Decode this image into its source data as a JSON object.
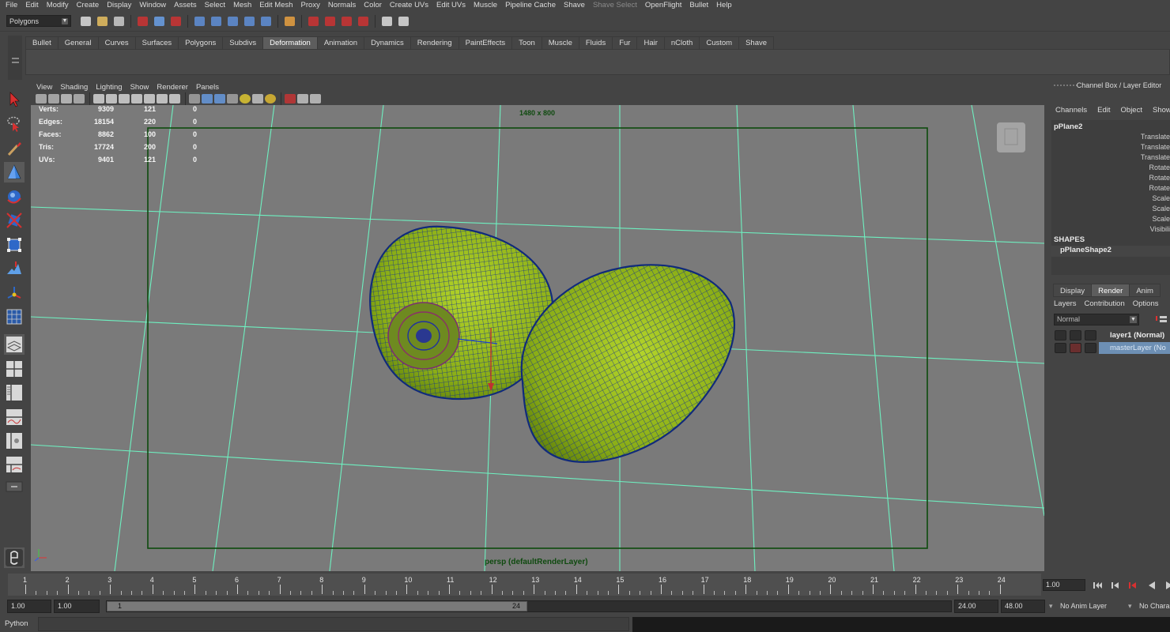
{
  "menubar": {
    "items": [
      "File",
      "Edit",
      "Modify",
      "Create",
      "Display",
      "Window",
      "Assets",
      "Select",
      "Mesh",
      "Edit Mesh",
      "Proxy",
      "Normals",
      "Color",
      "Create UVs",
      "Edit UVs",
      "Muscle",
      "Pipeline Cache",
      "Shave",
      "Shave Select",
      "OpenFlight",
      "Bullet",
      "Help"
    ],
    "disabled_item": "Shave Select"
  },
  "statusline": {
    "menuset": "Polygons",
    "tool_icons": [
      "new-scene-icon",
      "open-scene-icon",
      "save-scene-icon",
      "select-hierarchy-icon",
      "select-object-icon",
      "select-component-icon",
      "snap-grid-icon",
      "snap-curve-icon",
      "snap-point-icon",
      "snap-surface-icon",
      "snap-live-icon",
      "history-icon",
      "render-view-icon",
      "render-icon",
      "ipr-render-icon",
      "render-settings-icon",
      "hypershade-icon",
      "input-line-icon"
    ]
  },
  "shelf": {
    "tabs": [
      "Bullet",
      "General",
      "Curves",
      "Surfaces",
      "Polygons",
      "Subdivs",
      "Deformation",
      "Animation",
      "Dynamics",
      "Rendering",
      "PaintEffects",
      "Toon",
      "Muscle",
      "Fluids",
      "Fur",
      "Hair",
      "nCloth",
      "Custom",
      "Shave"
    ],
    "active_tab": "Deformation"
  },
  "toolbox": {
    "tools": [
      "select-tool-icon",
      "lasso-tool-icon",
      "paint-select-icon",
      "move-tool-icon",
      "rotate-tool-icon",
      "scale-tool-icon",
      "universal-manipulator-icon",
      "soft-mod-icon",
      "show-manipulator-icon",
      "grid-layout-icon",
      "single-perspective-layout-icon",
      "four-view-layout-icon",
      "persp-outliner-layout-icon",
      "persp-graph-layout-icon",
      "hypershade-layout-icon",
      "graph-outliner-layout-icon",
      "more-layouts-icon",
      "python-icon"
    ]
  },
  "viewport": {
    "panel_menu": [
      "View",
      "Shading",
      "Lighting",
      "Show",
      "Renderer",
      "Panels"
    ],
    "resolution_gate": "1480 x 800",
    "camera_label": "persp (defaultRenderLayer)",
    "hud": [
      {
        "label": "Verts:",
        "total": "9309",
        "selected": "121",
        "tris": "0"
      },
      {
        "label": "Edges:",
        "total": "18154",
        "selected": "220",
        "tris": "0"
      },
      {
        "label": "Faces:",
        "total": "8862",
        "selected": "100",
        "tris": "0"
      },
      {
        "label": "Tris:",
        "total": "17724",
        "selected": "200",
        "tris": "0"
      },
      {
        "label": "UVs:",
        "total": "9401",
        "selected": "121",
        "tris": "0"
      }
    ],
    "colors": {
      "background": "#7a7a7a",
      "grid": "#6ef0c0",
      "gate": "#0d4a0d",
      "mesh_fill": "#9bbf1c",
      "wireframe": "#16338a"
    }
  },
  "channelbox": {
    "title": "Channel Box / Layer Editor",
    "menu": [
      "Channels",
      "Edit",
      "Object",
      "Show"
    ],
    "object": "pPlane2",
    "attributes": [
      "Translate",
      "Translate",
      "Translate",
      "Rotate",
      "Rotate",
      "Rotate",
      "Scale",
      "Scale",
      "Scale",
      "Visibili"
    ],
    "shapes_header": "SHAPES",
    "shape": "pPlaneShape2"
  },
  "layer_editor": {
    "tabs": [
      "Display",
      "Render",
      "Anim"
    ],
    "active_tab": "Render",
    "menu": [
      "Layers",
      "Contribution",
      "Options"
    ],
    "mode": "Normal",
    "layers": [
      {
        "name": "layer1 (Normal)",
        "selected": false
      },
      {
        "name": "masterLayer (No",
        "selected": true
      }
    ]
  },
  "timeslider": {
    "ticks": [
      "1",
      "2",
      "3",
      "4",
      "5",
      "6",
      "7",
      "8",
      "9",
      "10",
      "11",
      "12",
      "13",
      "14",
      "15",
      "16",
      "17",
      "18",
      "19",
      "20",
      "21",
      "22",
      "23",
      "24"
    ],
    "current_frame": "1.00"
  },
  "rangeslider": {
    "start": "1.00",
    "anim_start": "1.00",
    "range_start_label": "1",
    "range_end_label": "24",
    "anim_end": "24.00",
    "end": "48.00",
    "anim_layer": "No Anim Layer",
    "character": "No Chara"
  },
  "commandline": {
    "label": "Python"
  }
}
